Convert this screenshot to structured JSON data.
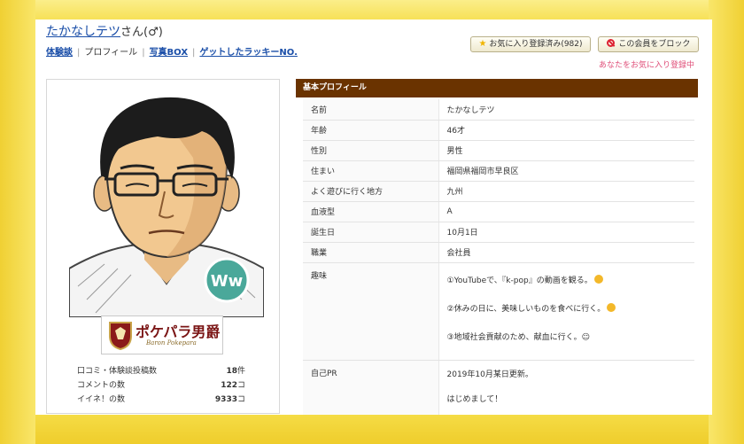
{
  "header": {
    "name": "たかなしテツ",
    "name_suffix": "さん(♂)"
  },
  "nav": {
    "items": [
      {
        "label": "体験談",
        "link": true
      },
      {
        "label": "プロフィール",
        "link": false
      },
      {
        "label": "写真BOX",
        "link": true
      },
      {
        "label": "ゲットしたラッキーNO.",
        "link": true
      }
    ]
  },
  "actions": {
    "favorite_label": "お気に入り登録済み(982)",
    "block_label": "この会員をブロック",
    "favorite_note": "あなたをお気に入り登録中"
  },
  "card": {
    "badge_text": "Ww",
    "banner_title": "ポケパラ男爵",
    "banner_subtitle": "Baron Pokepara",
    "stats": [
      {
        "label": "口コミ・体験談投稿数",
        "value": "18",
        "unit": "件"
      },
      {
        "label": "コメントの数",
        "value": "122",
        "unit": "コ"
      },
      {
        "label": "イイネ！の数",
        "value": "9333",
        "unit": "コ"
      }
    ]
  },
  "profile": {
    "section_title": "基本プロフィール",
    "rows": [
      {
        "label": "名前",
        "value": "たかなしテツ"
      },
      {
        "label": "年齢",
        "value": "46才"
      },
      {
        "label": "性別",
        "value": "男性"
      },
      {
        "label": "住まい",
        "value": "福岡県福岡市早良区"
      },
      {
        "label": "よく遊びに行く地方",
        "value": "九州"
      },
      {
        "label": "血液型",
        "value": "A"
      },
      {
        "label": "誕生日",
        "value": "10月1日"
      },
      {
        "label": "職業",
        "value": "会社員"
      }
    ],
    "hobby_label": "趣味",
    "hobby_lines": [
      "①YouTubeで、『k-pop』の動画を観る。",
      "②休みの日に、美味しいものを食べに行く。",
      "③地域社会貢献のため、献血に行く。☺"
    ],
    "pr_label": "自己PR",
    "pr_lines": [
      "2019年10月某日更新。",
      "はじめまして！"
    ]
  },
  "colors": {
    "frame": "#f7e35a",
    "header_brown": "#6a3300",
    "link_blue": "#1a4ea8",
    "note_pink": "#e0507a"
  }
}
